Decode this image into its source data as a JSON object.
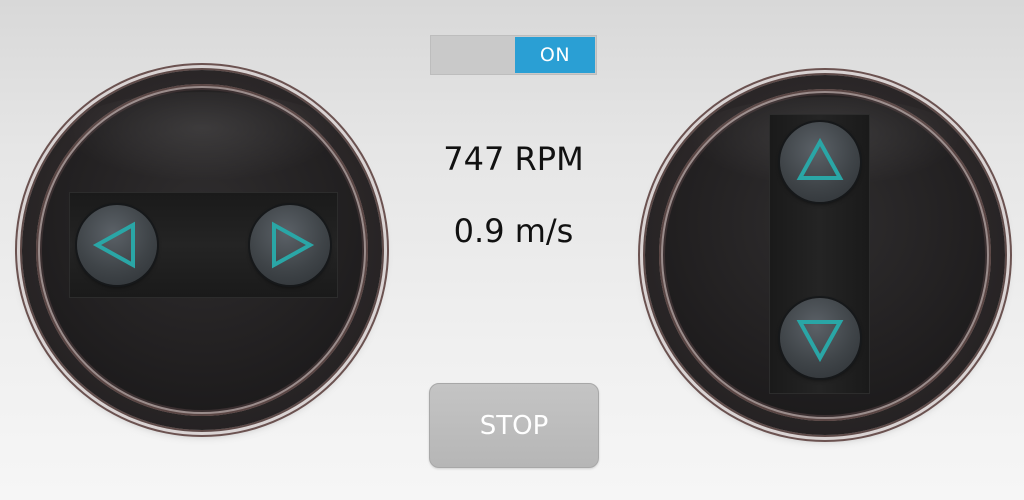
{
  "toggle": {
    "state_label": "ON",
    "state": "on",
    "accent_color": "#2a9fd4"
  },
  "readouts": {
    "rpm": "747 RPM",
    "speed": "0.9 m/s"
  },
  "stop_button": {
    "label": "STOP"
  },
  "left_pad": {
    "buttons": [
      "arrow-left-icon",
      "arrow-right-icon"
    ]
  },
  "right_pad": {
    "buttons": [
      "arrow-up-icon",
      "arrow-down-icon"
    ]
  },
  "colors": {
    "arrow": "#2aa6a6",
    "pad_body": "#222021",
    "button_face": "#454a4f"
  }
}
